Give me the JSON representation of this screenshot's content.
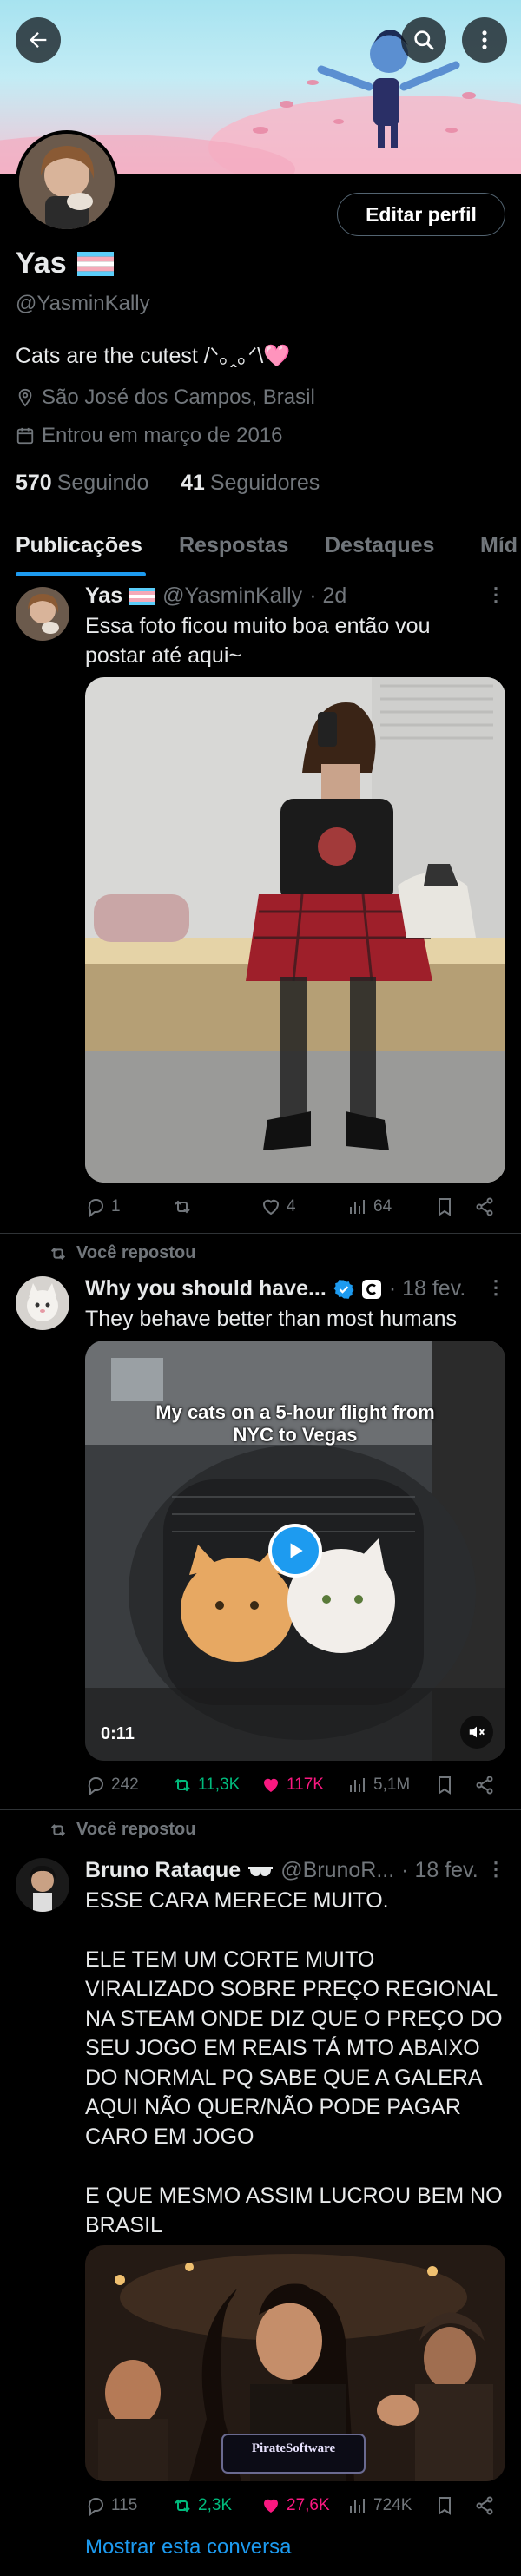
{
  "header": {
    "back_icon": "arrow-left-icon",
    "search_icon": "search-icon",
    "more_icon": "more-vertical-icon"
  },
  "profile": {
    "name": "Yas",
    "flag_icon": "trans-flag-icon",
    "handle": "@YasminKally",
    "bio": "Cats are the cutest /ᐠ｡ꞈ｡ᐟ\\🩷",
    "location": "São José dos Campos, Brasil",
    "joined": "Entrou em março de 2016",
    "following_count": "570",
    "following_label": "Seguindo",
    "followers_count": "41",
    "followers_label": "Seguidores",
    "edit_label": "Editar perfil"
  },
  "tabs": [
    {
      "label": "Publicações",
      "active": true
    },
    {
      "label": "Respostas",
      "active": false
    },
    {
      "label": "Destaques",
      "active": false
    },
    {
      "label": "Míd",
      "active": false
    }
  ],
  "posts": [
    {
      "name": "Yas",
      "handle": "@YasminKally",
      "time": "· 2d",
      "text": "Essa foto ficou muito boa então vou postar até aqui~",
      "stats": {
        "replies": "1",
        "reposts": "",
        "likes": "4",
        "views": "64"
      }
    },
    {
      "repost_label": "Você repostou",
      "name": "Why you should have...",
      "time": "· 18 fev.",
      "text": "They behave better than most humans",
      "video_caption": "My cats on a 5-hour flight from NYC to Vegas",
      "video_time": "0:11",
      "stats": {
        "replies": "242",
        "reposts": "11,3K",
        "likes": "117K",
        "views": "5,1M"
      }
    },
    {
      "repost_label": "Você repostou",
      "name": "Bruno Rataque",
      "handle": "@BrunoR...",
      "time": "· 18 fev.",
      "text": "ESSE CARA MERECE MUITO.\n\nELE TEM UM CORTE MUITO VIRALIZADO SOBRE PREÇO REGIONAL NA STEAM ONDE DIZ QUE O PREÇO DO SEU JOGO EM REAIS TÁ MTO ABAIXO DO NORMAL PQ SABE QUE A GALERA AQUI NÃO QUER/NÃO PODE PAGAR CARO EM JOGO\n\nE QUE MESMO ASSIM LUCROU BEM NO BRASIL",
      "image_caption": "PirateSoftware",
      "stats": {
        "replies": "115",
        "reposts": "2,3K",
        "likes": "27,6K",
        "views": "724K"
      },
      "show_thread": "Mostrar esta conversa"
    }
  ],
  "colors": {
    "accent": "#1d9bf0",
    "repost_active": "#00ba7c",
    "like_active": "#f91880",
    "background": "#000000"
  }
}
